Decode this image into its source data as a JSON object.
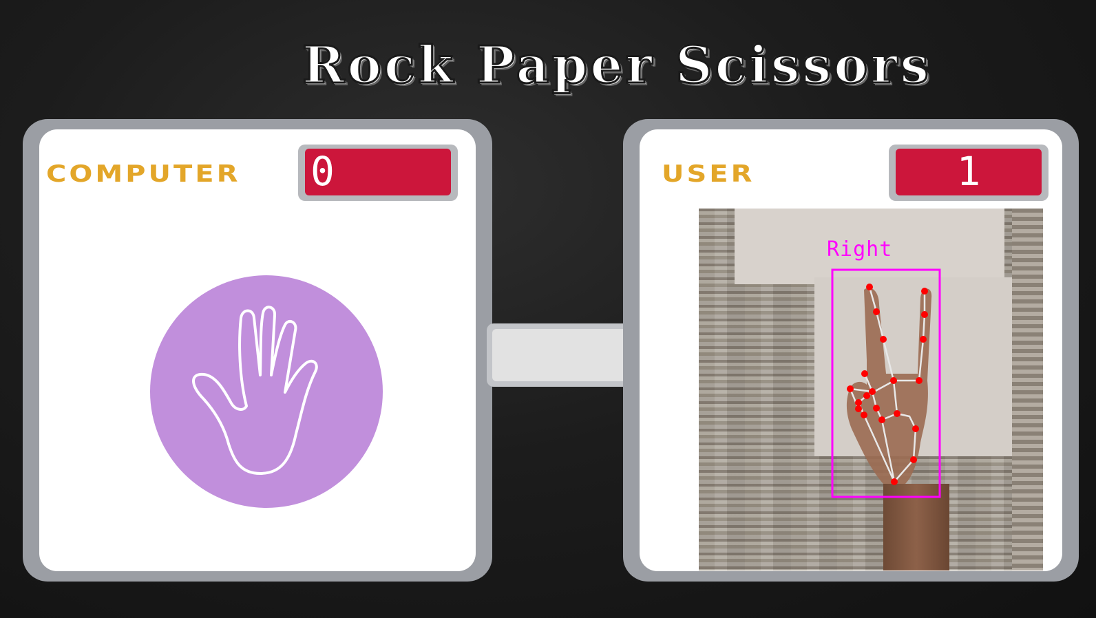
{
  "title": "Rock Paper Scissors",
  "computer": {
    "label": "COMPUTER",
    "score": "0",
    "move_icon": "paper-hand-icon"
  },
  "user": {
    "label": "USER",
    "score": "1",
    "camera": {
      "handedness_label": "Right",
      "detected_gesture_icon": "scissors-hand-landmarks"
    }
  },
  "colors": {
    "label_gold": "#e3a629",
    "score_red": "#cc163b",
    "hand_circle": "#c18fdc",
    "detection_box": "#ff00ff",
    "landmark_point": "#ff0000"
  }
}
